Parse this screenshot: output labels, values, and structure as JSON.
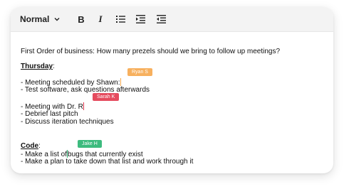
{
  "toolbar": {
    "format_select": "Normal",
    "bold_label": "B",
    "italic_label": "I",
    "icons": [
      "chevron-down-icon",
      "bulleted-list-icon",
      "indent-icon",
      "outdent-icon"
    ]
  },
  "document": {
    "intro": "First Order of business: How many prezels should we bring to follow up meetings?",
    "thursday_heading": "Thursday",
    "thursday_colon": ":",
    "line_meeting_shawn": "- Meeting scheduled by Shawn:",
    "line_test_software": "- Test software, ask questions afterwards",
    "line_meeting_dr": "- Meeting with Dr. R",
    "line_debrief": "- Debrief last pitch",
    "line_discuss": "- Discuss iteration techniques",
    "code_heading": "Code",
    "code_colon": ":",
    "line_list_a": "- Make a list of",
    "line_list_b": "bugs that currently exist",
    "line_plan": "- Make a plan to take down that list and work through it"
  },
  "collaborators": [
    {
      "name": "Ryan S",
      "color": "#f7b05e"
    },
    {
      "name": "Sarah K",
      "color": "#e54b5e"
    },
    {
      "name": "Jake H",
      "color": "#3dbb7e"
    }
  ]
}
